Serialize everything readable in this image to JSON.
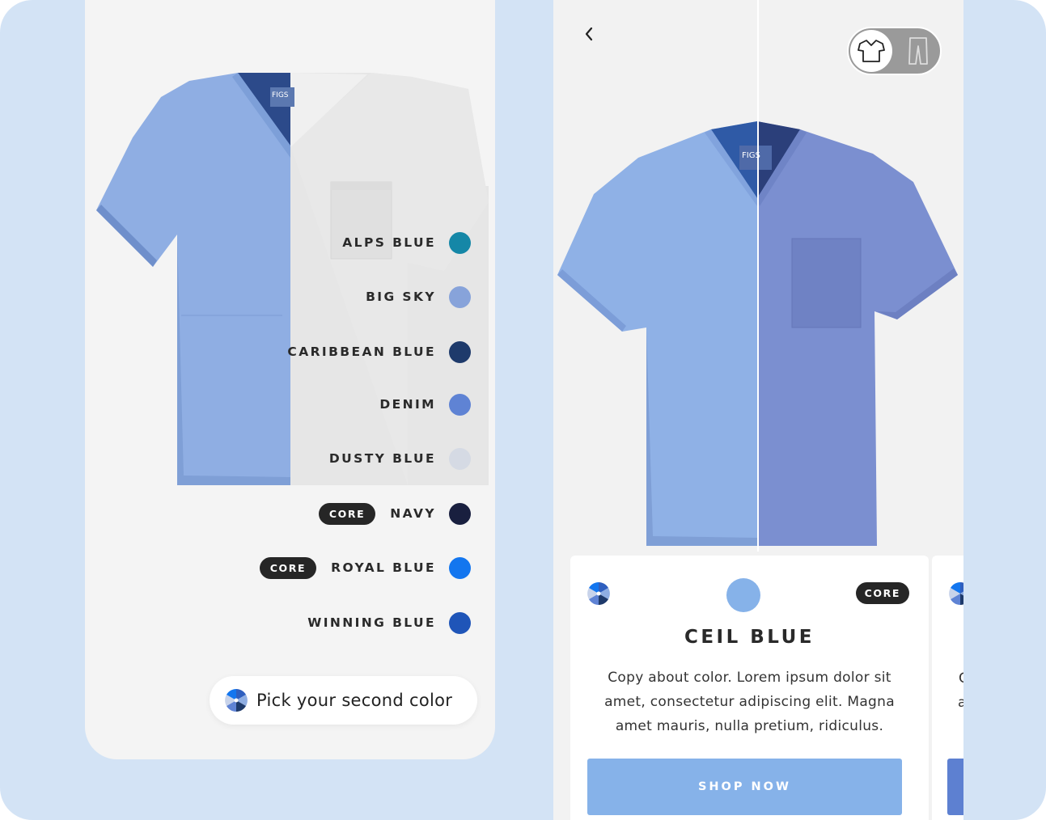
{
  "colors": {
    "background": "#d3e3f5",
    "panel": "#f4f4f4",
    "scrub_left": "#8fb1e6",
    "scrub_right": "#7b8fd0",
    "accent_button": "#86b2e9",
    "badge": "#262626"
  },
  "left_panel": {
    "swatches": [
      {
        "name": "ALPS BLUE",
        "color": "#1587a7",
        "core": false
      },
      {
        "name": "BIG SKY",
        "color": "#87a3da",
        "core": false
      },
      {
        "name": "CARIBBEAN BLUE",
        "color": "#1e3a6b",
        "core": false
      },
      {
        "name": "DENIM",
        "color": "#5f83d4",
        "core": false
      },
      {
        "name": "DUSTY BLUE",
        "color": "#d5dae4",
        "core": false
      },
      {
        "name": "NAVY",
        "color": "#191f3f",
        "core": true
      },
      {
        "name": "ROYAL BLUE",
        "color": "#1376ef",
        "core": true
      },
      {
        "name": "WINNING BLUE",
        "color": "#1f55b8",
        "core": false
      }
    ],
    "core_label": "CORE",
    "pick_button_label": "Pick your second color",
    "pick_icon": "color-wheel-icon"
  },
  "right_panel": {
    "back_icon": "chevron-left-icon",
    "toggle": {
      "selected": "top",
      "options": [
        "shirt-icon",
        "pants-icon"
      ]
    },
    "card": {
      "core_label": "CORE",
      "swatch_color": "#86b2e9",
      "title": "CEIL BLUE",
      "copy_lines": [
        "Copy about color. Lorem ipsum dolor sit",
        "amet, consectetur adipiscing elit. Magna",
        "amet mauris, nulla pretium, ridiculus."
      ],
      "shop_label": "SHOP NOW"
    },
    "peek_card": {
      "copy_glyphs": [
        "C",
        "a"
      ],
      "button_color": "#5d80d1"
    }
  }
}
